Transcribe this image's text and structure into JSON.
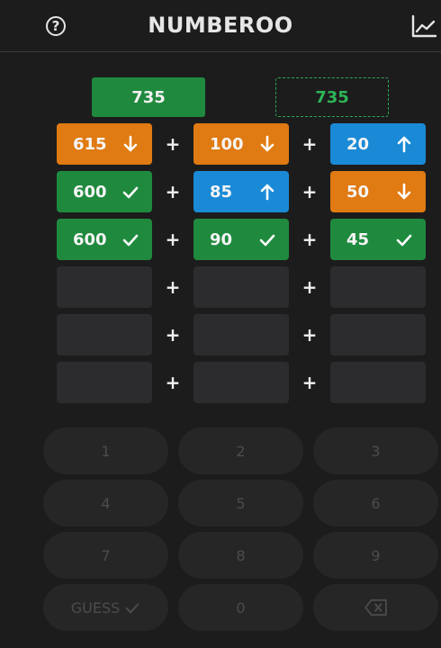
{
  "header": {
    "title": "NUMBEROO",
    "help_label": "?"
  },
  "target": {
    "value": "735",
    "current_sum": "735"
  },
  "guesses": [
    [
      {
        "value": "615",
        "status": "orange",
        "indicator": "arrow-down-icon"
      },
      {
        "value": "100",
        "status": "orange",
        "indicator": "arrow-down-icon"
      },
      {
        "value": "20",
        "status": "blue",
        "indicator": "arrow-up-icon"
      }
    ],
    [
      {
        "value": "600",
        "status": "green",
        "indicator": "check-icon"
      },
      {
        "value": "85",
        "status": "blue",
        "indicator": "arrow-up-icon"
      },
      {
        "value": "50",
        "status": "orange",
        "indicator": "arrow-down-icon"
      }
    ],
    [
      {
        "value": "600",
        "status": "green",
        "indicator": "check-icon"
      },
      {
        "value": "90",
        "status": "green",
        "indicator": "check-icon"
      },
      {
        "value": "45",
        "status": "green",
        "indicator": "check-icon"
      }
    ],
    [
      {
        "value": ""
      },
      {
        "value": ""
      },
      {
        "value": ""
      }
    ],
    [
      {
        "value": ""
      },
      {
        "value": ""
      },
      {
        "value": ""
      }
    ],
    [
      {
        "value": ""
      },
      {
        "value": ""
      },
      {
        "value": ""
      }
    ]
  ],
  "operator": "+",
  "keypad": {
    "keys": [
      "1",
      "2",
      "3",
      "4",
      "5",
      "6",
      "7",
      "8",
      "9"
    ],
    "guess_label": "GUESS",
    "zero": "0",
    "backspace_icon": "backspace-icon"
  },
  "colors": {
    "background": "#1c1c1d",
    "green": "#1f8a3e",
    "orange": "#e07a12",
    "blue": "#1a8ad6",
    "empty_cell": "#2c2c2e",
    "key": "#262627"
  }
}
